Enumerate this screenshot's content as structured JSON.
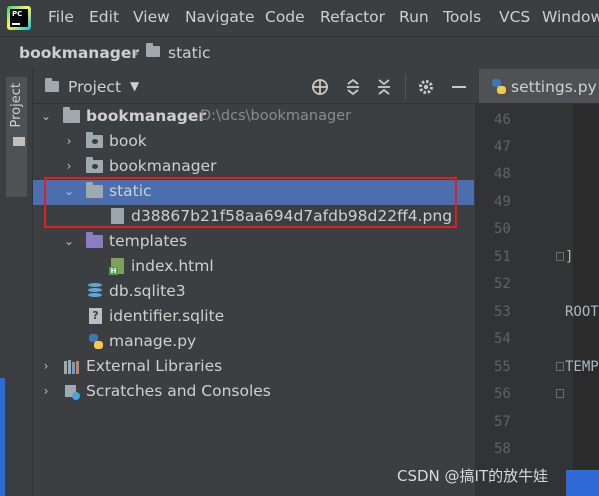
{
  "menubar": {
    "logo_text": "PC",
    "items": [
      "File",
      "Edit",
      "View",
      "Navigate",
      "Code",
      "Refactor",
      "Run",
      "Tools",
      "VCS",
      "Window"
    ]
  },
  "navbar": {
    "crumbs": [
      "bookmanager",
      "static"
    ]
  },
  "left_strip": {
    "tab_label": "Project"
  },
  "project_panel": {
    "title": "Project",
    "tree": [
      {
        "label": "bookmanager",
        "path": "D:\\dcs\\bookmanager",
        "icon": "folder",
        "expanded": true
      },
      {
        "label": "book",
        "icon": "package-folder",
        "expanded": false
      },
      {
        "label": "bookmanager",
        "icon": "package-folder",
        "expanded": false
      },
      {
        "label": "static",
        "icon": "folder",
        "expanded": true,
        "selected": true
      },
      {
        "label": "d38867b21f58aa694d7afdb98d22ff4.png",
        "icon": "image-file"
      },
      {
        "label": "templates",
        "icon": "folder-purple",
        "expanded": true
      },
      {
        "label": "index.html",
        "icon": "html-file"
      },
      {
        "label": "db.sqlite3",
        "icon": "database-file"
      },
      {
        "label": "identifier.sqlite",
        "icon": "unknown-file"
      },
      {
        "label": "manage.py",
        "icon": "python-file"
      },
      {
        "label": "External Libraries",
        "icon": "libraries",
        "expanded": false
      },
      {
        "label": "Scratches and Consoles",
        "icon": "scratches",
        "expanded": false
      }
    ]
  },
  "editor": {
    "tab_label": "settings.py",
    "line_numbers": [
      "46",
      "47",
      "48",
      "49",
      "50",
      "51",
      "52",
      "53",
      "54",
      "55",
      "56",
      "57",
      "58"
    ],
    "code_lines": {
      "l51": "]",
      "l53": "ROOT",
      "l55": "TEMP"
    }
  },
  "watermark": "CSDN @搞IT的放牛娃",
  "colors": {
    "selection": "#4b6eaf",
    "highlight_box": "#e02020",
    "background": "#3c3f41"
  }
}
